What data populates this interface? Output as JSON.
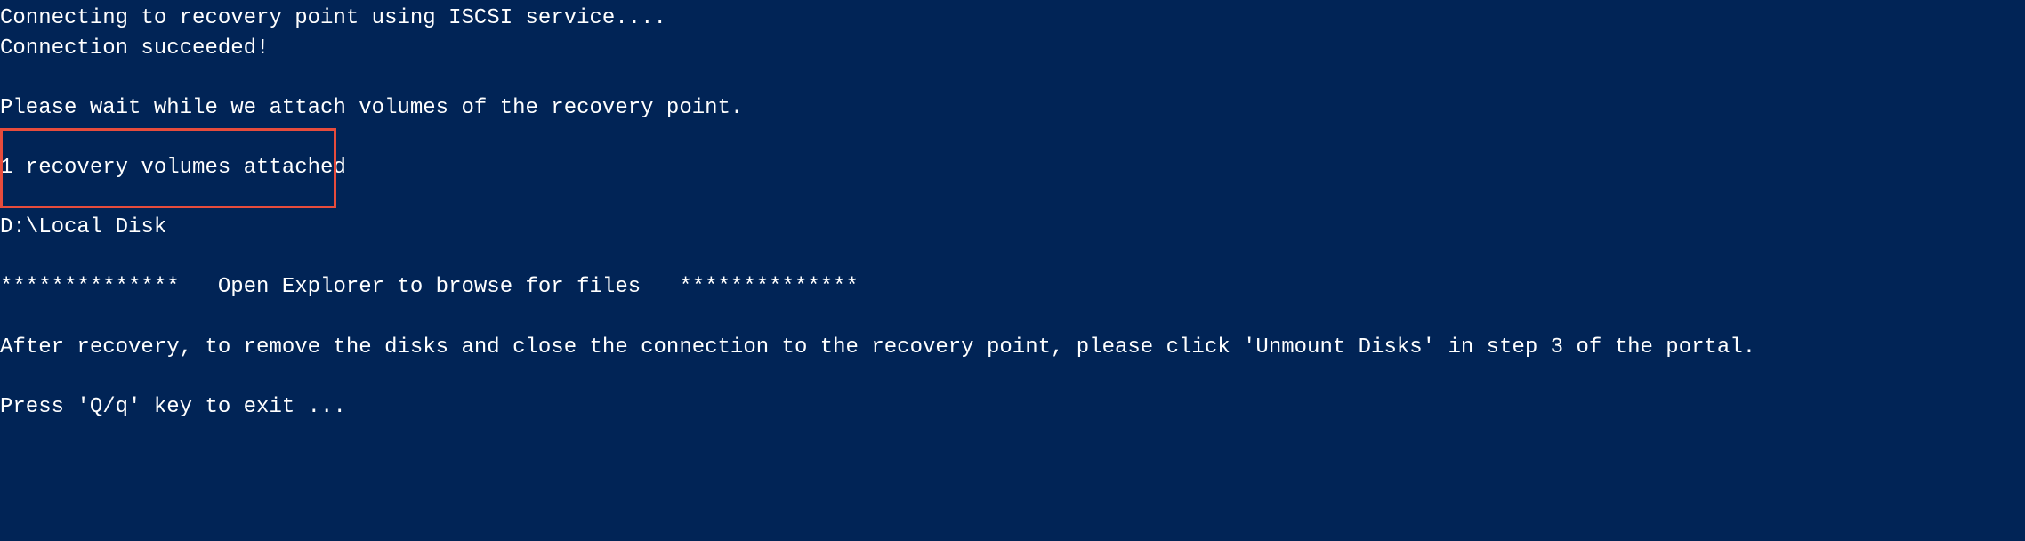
{
  "terminal": {
    "line1": "Connecting to recovery point using ISCSI service....",
    "line2": "Connection succeeded!",
    "line3": "Please wait while we attach volumes of the recovery point.",
    "line4": "1 recovery volumes attached",
    "line5": "D:\\Local Disk",
    "line6": "**************   Open Explorer to browse for files   **************",
    "line7": "After recovery, to remove the disks and close the connection to the recovery point, please click 'Unmount Disks' in step 3 of the portal.",
    "line8": "Press 'Q/q' key to exit ..."
  }
}
